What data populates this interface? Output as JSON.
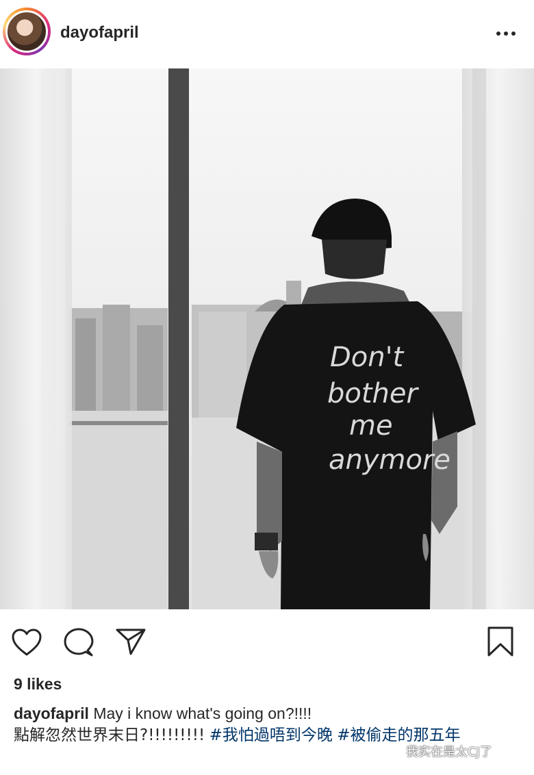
{
  "header": {
    "username": "dayofapril",
    "avatar_icon": "profile-avatar",
    "more_icon": "more-horizontal-icon"
  },
  "post": {
    "shirt_text": [
      "Don't",
      "bother",
      "me",
      "anymore"
    ]
  },
  "actions": {
    "like_icon": "heart-icon",
    "comment_icon": "comment-icon",
    "share_icon": "paper-plane-icon",
    "save_icon": "bookmark-icon"
  },
  "likes": "9 likes",
  "caption": {
    "username": "dayofapril",
    "text_line1": "May i know what's going on?!!!!",
    "text_line2": "點解忽然世界末日?!!!!!!!!!",
    "hashtag1": "#我怕過唔到今晚",
    "hashtag2": "#被偷走的那五年"
  },
  "watermark": {
    "text": "我实在是太CJ了",
    "icon": "wechat-icon"
  },
  "colors": {
    "text": "#262626",
    "hashtag": "#003569",
    "avatar_ring": "#dd2a7b"
  }
}
